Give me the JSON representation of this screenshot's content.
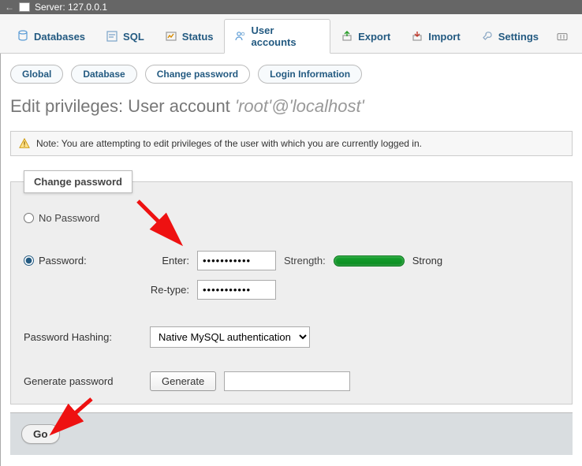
{
  "topbar": {
    "arrow": "←",
    "server_label": "Server: 127.0.0.1"
  },
  "tabs": {
    "databases": "Databases",
    "sql": "SQL",
    "status": "Status",
    "user_accounts": "User accounts",
    "export": "Export",
    "import": "Import",
    "settings": "Settings"
  },
  "subtabs": {
    "global": "Global",
    "database": "Database",
    "change_password": "Change password",
    "login_info": "Login Information"
  },
  "heading": {
    "prefix": "Edit privileges: User account ",
    "ident": "'root'@'localhost'"
  },
  "notice": "Note: You are attempting to edit privileges of the user with which you are currently logged in.",
  "fieldset_legend": "Change password",
  "form": {
    "no_password": "No Password",
    "password": "Password:",
    "enter": "Enter:",
    "retype": "Re-type:",
    "masked": "•••••••••••",
    "strength_label": "Strength:",
    "strength_value": "Strong",
    "hashing_label": "Password Hashing:",
    "hashing_value": "Native MySQL authentication",
    "gen_label": "Generate password",
    "gen_button": "Generate",
    "gen_value": ""
  },
  "footer": {
    "go": "Go"
  }
}
